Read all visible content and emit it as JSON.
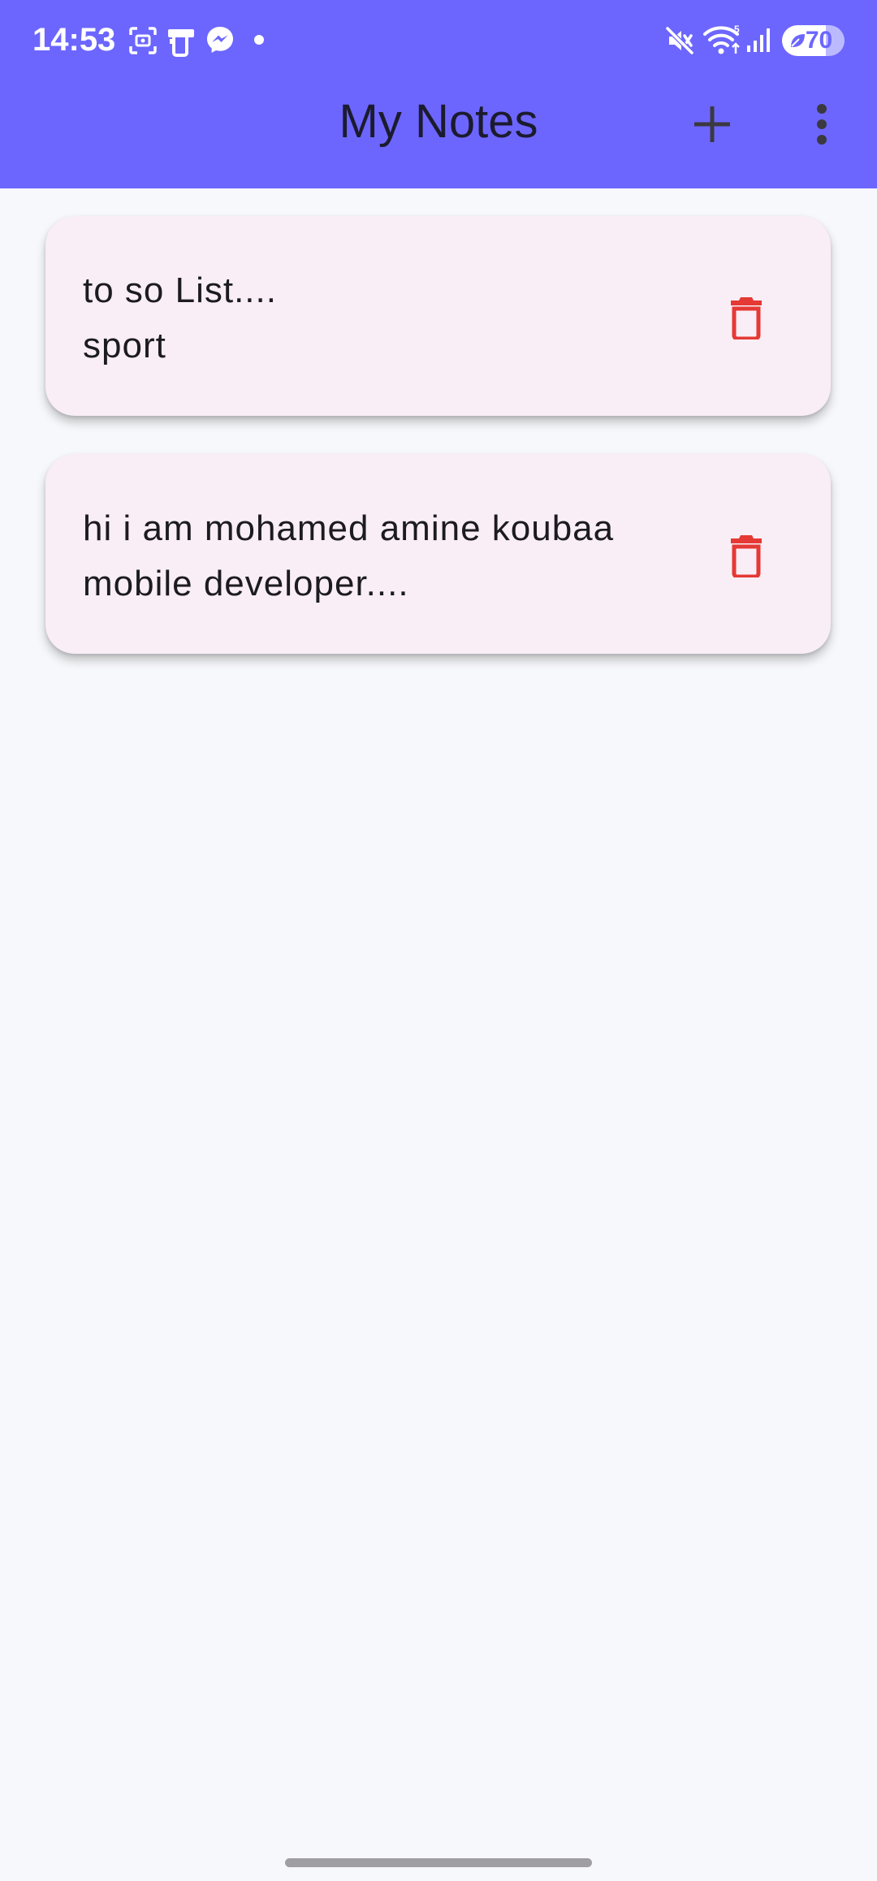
{
  "status_bar": {
    "time": "14:53",
    "battery_level": "70",
    "battery_fraction": 0.7,
    "icons": [
      "screenshot-icon",
      "device-icon",
      "messenger-icon",
      "dot-icon",
      "mute-icon",
      "wifi-icon",
      "signal-icon",
      "battery-icon"
    ]
  },
  "app_bar": {
    "title": "My Notes",
    "add_icon": "plus-icon",
    "menu_icon": "more-vert-icon"
  },
  "notes": [
    {
      "text": "to so List....\nsport"
    },
    {
      "text": "hi i am mohamed amine koubaa\nmobile developer...."
    }
  ],
  "colors": {
    "app_bar": "#6c66ff",
    "background": "#f7f8fb",
    "card": "#f9eef5",
    "delete_icon": "#e53935"
  }
}
